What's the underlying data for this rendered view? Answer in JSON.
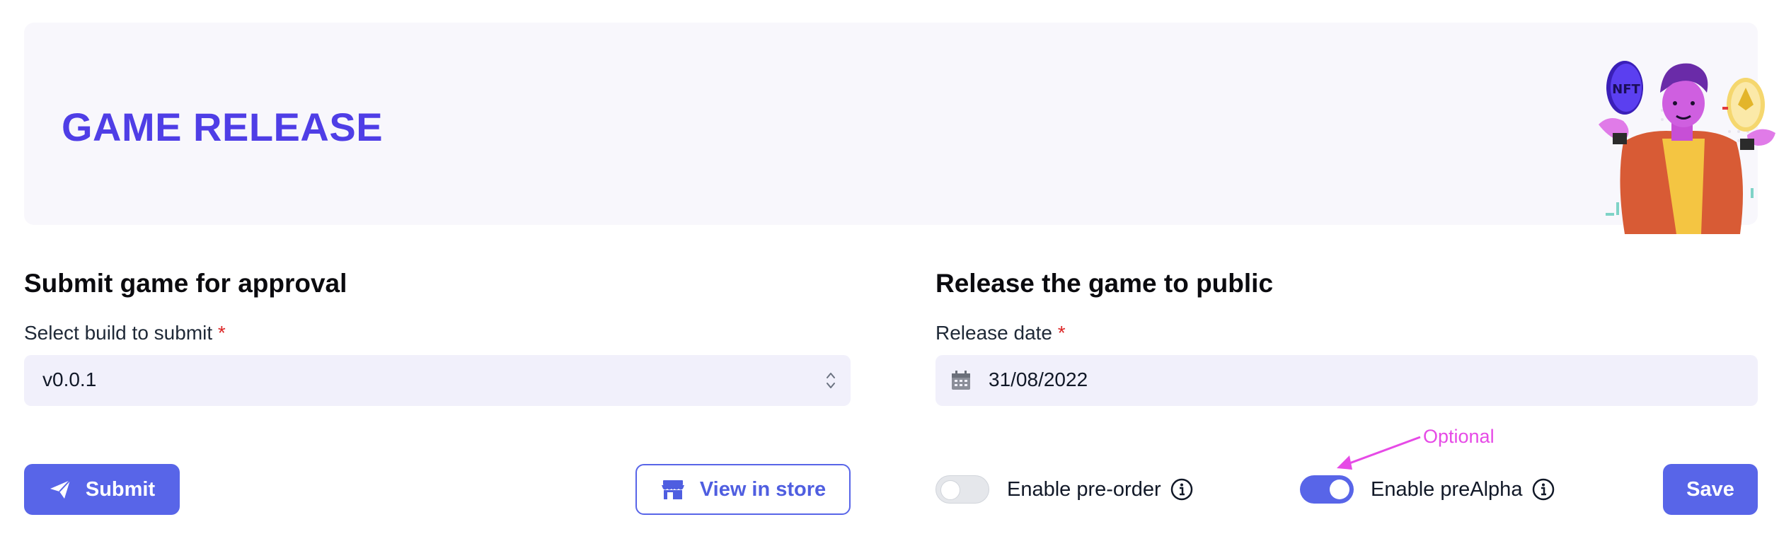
{
  "banner": {
    "title": "GAME RELEASE",
    "illustration_icon": "nft-character-illustration",
    "nft_badge": "NFT"
  },
  "submit_section": {
    "title": "Submit game for approval",
    "build_label": "Select build to submit",
    "required_mark": "*",
    "build_value": "v0.0.1",
    "submit_label": "Submit",
    "submit_icon": "paper-plane-icon",
    "store_label": "View in store",
    "store_icon": "store-icon"
  },
  "release_section": {
    "title": "Release the game to public",
    "date_label": "Release date",
    "required_mark": "*",
    "date_value": "31/08/2022",
    "date_icon": "calendar-icon",
    "preorder_label": "Enable pre-order",
    "preorder_enabled": false,
    "prealpha_label": "Enable preAlpha",
    "prealpha_enabled": true,
    "save_label": "Save"
  },
  "annotation": {
    "text": "Optional"
  },
  "colors": {
    "accent": "#5865e8",
    "title": "#4f3ee6",
    "banner_bg": "#f8f7fc",
    "field_bg": "#f1f0fb",
    "required": "#dc2626",
    "annotation": "#e64ae6"
  }
}
